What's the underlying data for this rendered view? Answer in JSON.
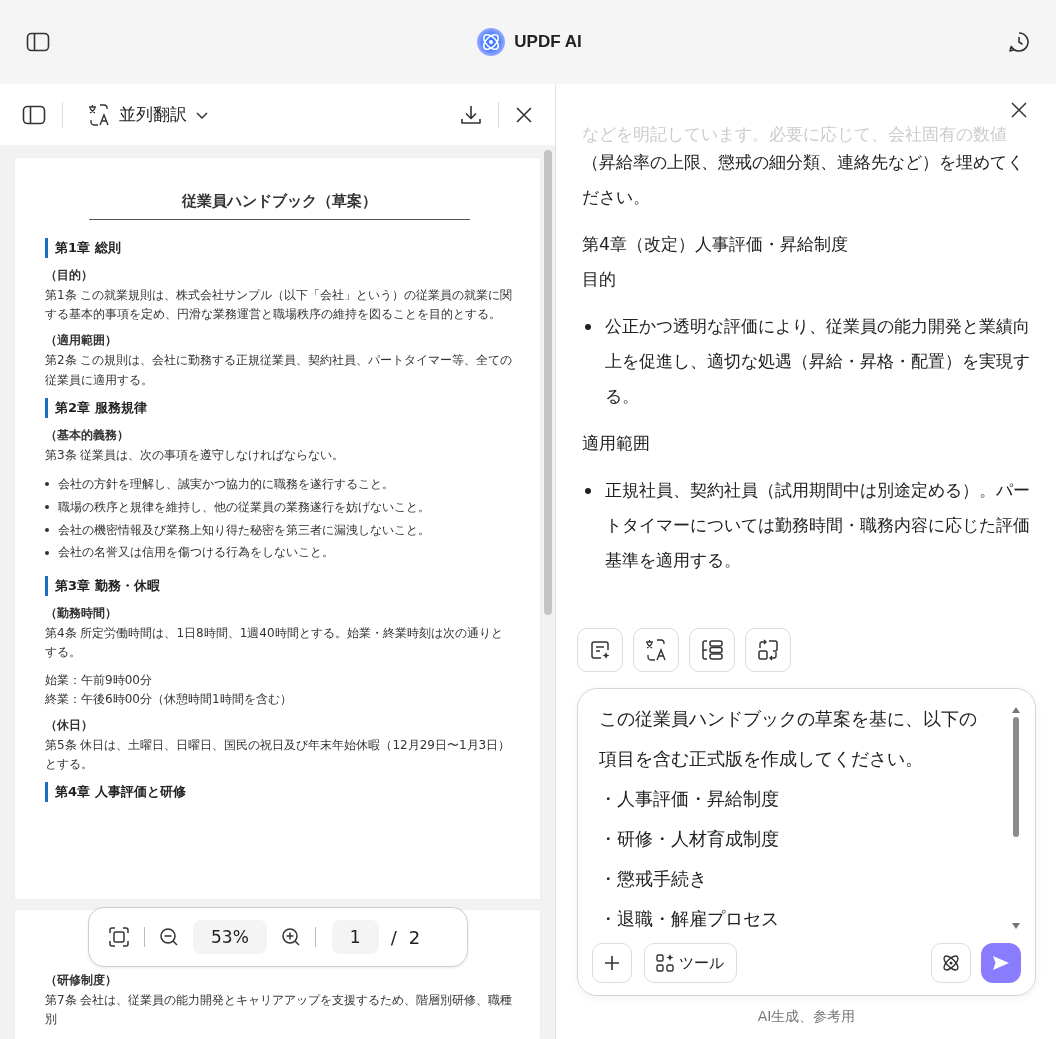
{
  "header": {
    "title": "UPDF AI"
  },
  "doc_toolbar": {
    "mode": "並列翻訳"
  },
  "document": {
    "pages": [
      {
        "blocks": [
          {
            "kind": "title",
            "text": "従業員ハンドブック（草案）"
          },
          {
            "kind": "chapter",
            "text": "第1章 総則"
          },
          {
            "kind": "heading",
            "text": "（目的）"
          },
          {
            "kind": "para",
            "text": "第1条 この就業規則は、株式会社サンプル（以下「会社」という）の従業員の就業に関する基本的事項を定め、円滑な業務運営と職場秩序の維持を図ることを目的とする。"
          },
          {
            "kind": "heading",
            "text": "（適用範囲）"
          },
          {
            "kind": "para",
            "text": "第2条 この規則は、会社に勤務する正規従業員、契約社員、パートタイマー等、全ての従業員に適用する。"
          },
          {
            "kind": "chapter",
            "text": "第2章 服務規律"
          },
          {
            "kind": "heading",
            "text": "（基本的義務）"
          },
          {
            "kind": "para",
            "text": "第3条 従業員は、次の事項を遵守しなければならない。"
          },
          {
            "kind": "bullet",
            "text": "会社の方針を理解し、誠実かつ協力的に職務を遂行すること。"
          },
          {
            "kind": "bullet",
            "text": "職場の秩序と規律を維持し、他の従業員の業務遂行を妨げないこと。"
          },
          {
            "kind": "bullet",
            "text": "会社の機密情報及び業務上知り得た秘密を第三者に漏洩しないこと。"
          },
          {
            "kind": "bullet",
            "text": "会社の名誉又は信用を傷つける行為をしないこと。"
          },
          {
            "kind": "chapter",
            "text": "第3章 勤務・休暇"
          },
          {
            "kind": "heading",
            "text": "（勤務時間）"
          },
          {
            "kind": "para",
            "text": "第4条 所定労働時間は、1日8時間、1週40時間とする。始業・終業時刻は次の通りとする。"
          },
          {
            "kind": "line",
            "text": "始業：午前9時00分"
          },
          {
            "kind": "line",
            "text": "終業：午後6時00分（休憩時間1時間を含む）"
          },
          {
            "kind": "heading",
            "text": "（休日）"
          },
          {
            "kind": "para",
            "text": "第5条 休日は、土曜日、日曜日、国民の祝日及び年末年始休暇（12月29日〜1月3日）とする。"
          },
          {
            "kind": "chapter",
            "text": "第4章 人事評価と研修"
          }
        ]
      },
      {
        "blocks": [
          {
            "kind": "heading",
            "text": "（研修制度）"
          },
          {
            "kind": "para",
            "text": "第7条 会社は、従業員の能力開発とキャリアアップを支援するため、階層別研修、職種別"
          }
        ]
      }
    ]
  },
  "zoom_bar": {
    "zoom": "53%",
    "page": "1",
    "separator": "/",
    "total": "2"
  },
  "chat": {
    "blocks": [
      {
        "kind": "fade",
        "text": "などを明記しています。必要に応じて、会社固有の数値"
      },
      {
        "kind": "para",
        "text": "（昇給率の上限、懲戒の細分類、連絡先など）を埋めてください。"
      },
      {
        "kind": "label",
        "text": "第4章（改定）人事評価・昇給制度"
      },
      {
        "kind": "para",
        "text": "目的"
      },
      {
        "kind": "bullet",
        "text": "公正かつ透明な評価により、従業員の能力開発と業績向上を促進し、適切な処遇（昇給・昇格・配置）を実現する。"
      },
      {
        "kind": "para",
        "text": "適用範囲"
      },
      {
        "kind": "bullet",
        "text": "正規社員、契約社員（試用期間中は別途定める）。パートタイマーについては勤務時間・職務内容に応じた評価基準を適用する。"
      }
    ]
  },
  "quick_actions": [
    {
      "kind": "summary"
    },
    {
      "kind": "translate"
    },
    {
      "kind": "outline"
    },
    {
      "kind": "swap"
    }
  ],
  "input": {
    "lines": [
      "この従業員ハンドブックの草案を基に、以下の項目を含む正式版を作成してください。",
      "・人事評価・昇給制度",
      "・研修・人材育成制度",
      "・懲戒手続き",
      "・退職・解雇プロセス"
    ],
    "tools_label": "ツール"
  },
  "footer": {
    "note": "AI生成、参考用"
  }
}
